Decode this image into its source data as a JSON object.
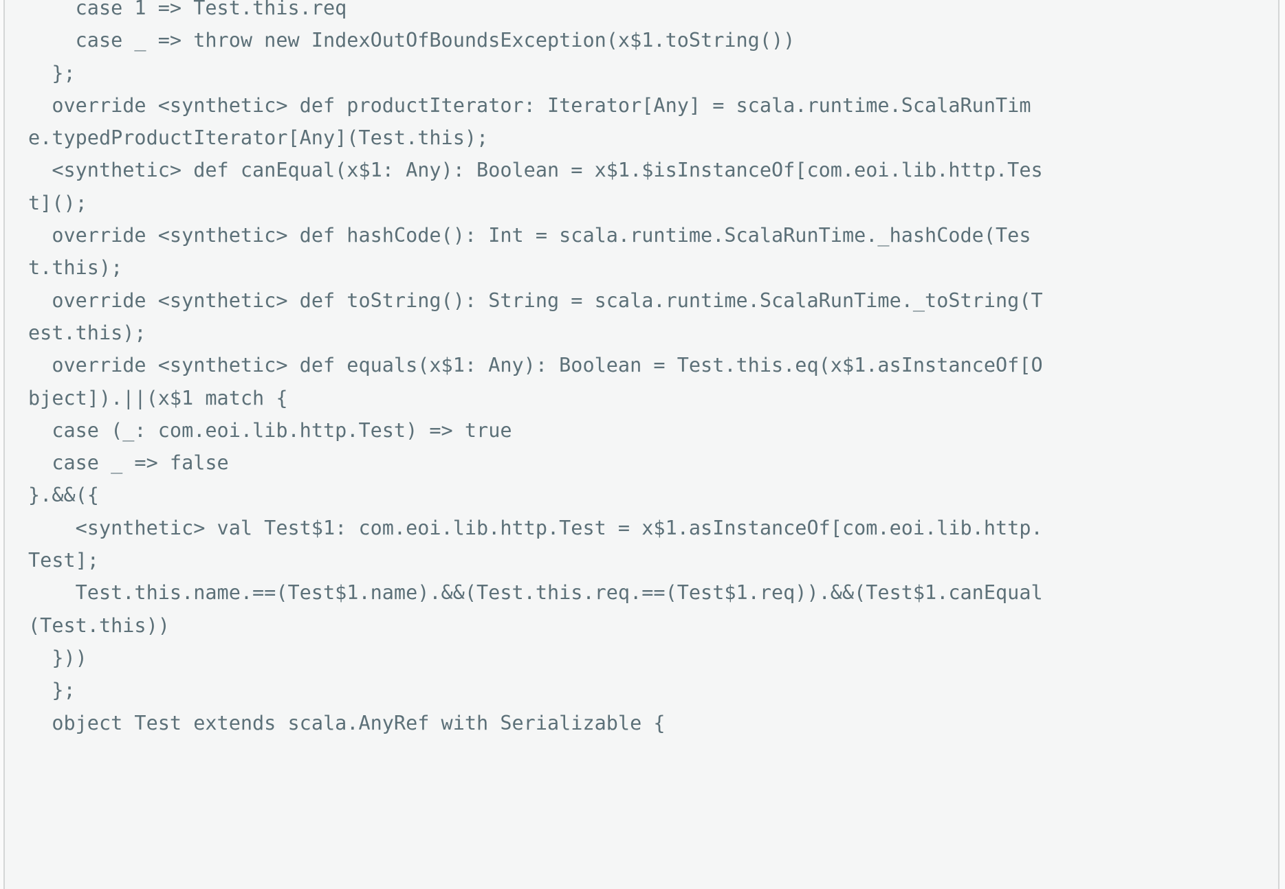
{
  "panel": {
    "kind": "code-viewer",
    "language": "scala",
    "background_color": "#f5f6f6",
    "text_color": "#5c7078",
    "rule_color": "#d4d6d6",
    "wrap_columns": 86
  },
  "code": {
    "content": "    case 1 => Test.this.req\n    case _ => throw new IndexOutOfBoundsException(x$1.toString())\n  };\n  override <synthetic> def productIterator: Iterator[Any] = scala.runtime.ScalaRunTime.typedProductIterator[Any](Test.this);\n  <synthetic> def canEqual(x$1: Any): Boolean = x$1.$isInstanceOf[com.eoi.lib.http.Test]();\n  override <synthetic> def hashCode(): Int = scala.runtime.ScalaRunTime._hashCode(Test.this);\n  override <synthetic> def toString(): String = scala.runtime.ScalaRunTime._toString(Test.this);\n  override <synthetic> def equals(x$1: Any): Boolean = Test.this.eq(x$1.asInstanceOf[Object]).||(x$1 match {\n  case (_: com.eoi.lib.http.Test) => true\n  case _ => false\n}.&&({\n    <synthetic> val Test$1: com.eoi.lib.http.Test = x$1.asInstanceOf[com.eoi.lib.http.Test];\n    Test.this.name.==(Test$1.name).&&(Test.this.req.==(Test$1.req)).&&(Test$1.canEqual(Test.this))\n  }))\n  };\n  object Test extends scala.AnyRef with Serializable {",
    "visual_lines": [
      "    case 1 => Test.this.req",
      "    case _ => throw new IndexOutOfBoundsException(x$1.toString())",
      "  };",
      "  override <synthetic> def productIterator: Iterator[Any] = scala.runtime.ScalaRunTime",
      ".typedProductIterator[Any](Test.this);",
      "  <synthetic> def canEqual(x$1: Any): Boolean = x$1.$isInstanceOf[com.eoi.lib.http.Tes",
      "t]();",
      "  override <synthetic> def hashCode(): Int = scala.runtime.ScalaRunTime._hashCode(Test",
      ".this);",
      "  override <synthetic> def toString(): String = scala.runtime.ScalaRunTime._toString(T",
      "est.this);",
      "  override <synthetic> def equals(x$1: Any): Boolean = Test.this.eq(x$1.asInstanceOf[O",
      "bject]).||(x$1 match {",
      "  case (_: com.eoi.lib.http.Test) => true",
      "  case _ => false",
      "}.&&({",
      "    <synthetic> val Test$1: com.eoi.lib.http.Test = x$1.asInstanceOf[com.eoi.lib.http.",
      "Test];",
      "    Test.this.name.==(Test$1.name).&&(Test.this.req.==(Test$1.req)).&&(Test$1.canEqual",
      "(Test.this))",
      "  }))",
      "  };",
      "  object Test extends scala.AnyRef with Serializable {"
    ]
  }
}
